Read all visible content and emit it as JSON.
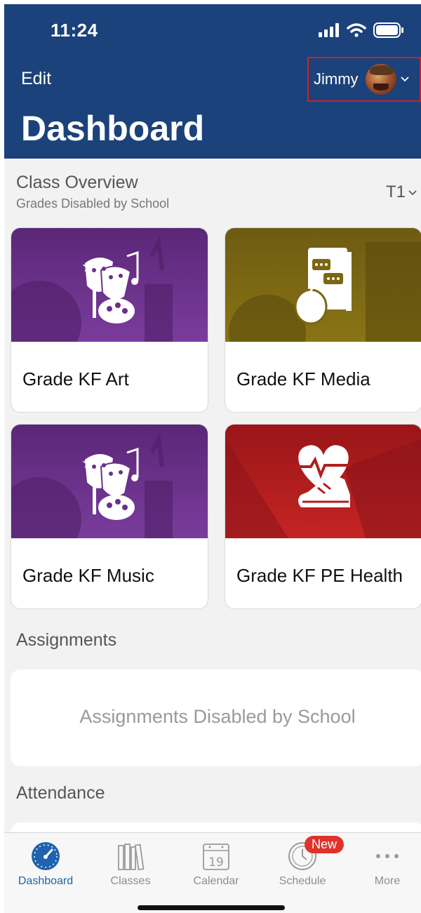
{
  "status": {
    "time": "11:24"
  },
  "header": {
    "edit_label": "Edit",
    "user_name": "Jimmy",
    "title": "Dashboard"
  },
  "overview": {
    "title": "Class Overview",
    "subtitle": "Grades Disabled by School",
    "term": "T1"
  },
  "classes": [
    {
      "name": "Grade KF Art",
      "icon": "theater-masks-palette-icon",
      "color": "#6a3089"
    },
    {
      "name": "Grade KF Media",
      "icon": "book-apple-icon",
      "color": "#7b6712"
    },
    {
      "name": "Grade KF Music",
      "icon": "theater-masks-palette-icon",
      "color": "#6a3089"
    },
    {
      "name": "Grade KF PE Health",
      "icon": "heart-sneaker-icon",
      "color": "#b21e1f"
    }
  ],
  "assignments": {
    "title": "Assignments",
    "message": "Assignments Disabled by School"
  },
  "attendance": {
    "title": "Attendance"
  },
  "tabs": [
    {
      "label": "Dashboard",
      "icon": "gauge-icon",
      "active": true
    },
    {
      "label": "Classes",
      "icon": "books-icon"
    },
    {
      "label": "Calendar",
      "icon": "calendar-icon",
      "day": "19"
    },
    {
      "label": "Schedule",
      "icon": "clock-icon",
      "badge": "New"
    },
    {
      "label": "More",
      "icon": "more-dots-icon"
    }
  ],
  "colors": {
    "header": "#1b427a",
    "accent": "#1f63b0",
    "badge": "#e0322b"
  }
}
